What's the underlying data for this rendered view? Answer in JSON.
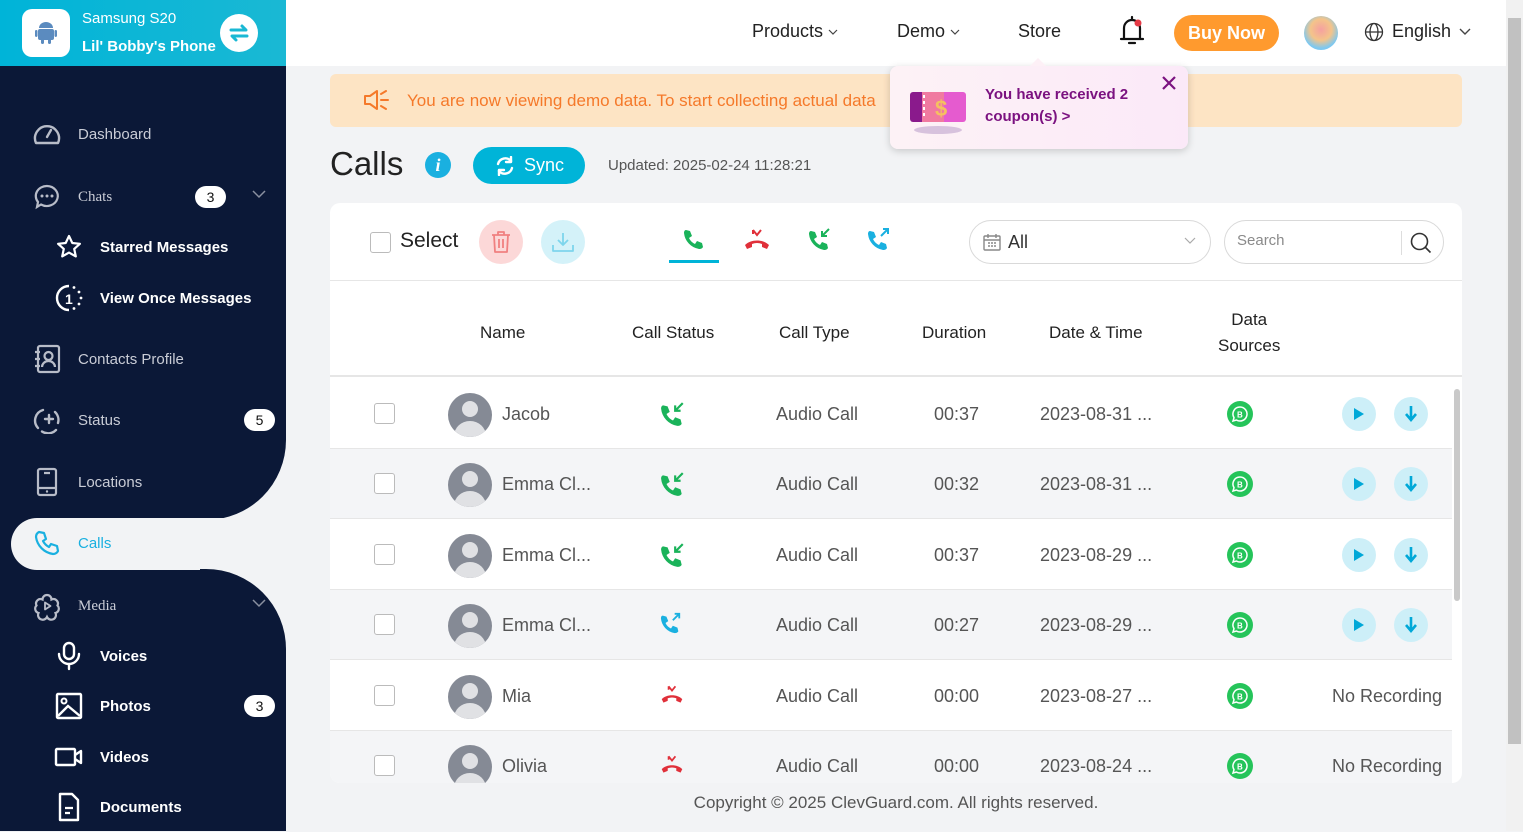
{
  "device": {
    "model": "Samsung S20",
    "name": "Lil' Bobby's Phone",
    "icon": "android-icon",
    "switch_icon": "switch-device-icon"
  },
  "sidebar": {
    "items": [
      {
        "label": "Dashboard",
        "icon": "dashboard-gauge-icon"
      },
      {
        "label": "Chats",
        "icon": "chat-bubble-icon",
        "badge": "3",
        "expandable": true
      },
      {
        "label": "Starred Messages",
        "icon": "star-icon",
        "sub": true
      },
      {
        "label": "View Once Messages",
        "icon": "view-once-icon",
        "sub": true
      },
      {
        "label": "Contacts Profile",
        "icon": "contacts-icon"
      },
      {
        "label": "Status",
        "icon": "status-add-icon",
        "badge": "5"
      },
      {
        "label": "Locations",
        "icon": "phone-device-icon"
      },
      {
        "label": "Calls",
        "icon": "phone-icon",
        "active": true
      },
      {
        "label": "Media",
        "icon": "media-flower-icon",
        "expandable": true
      },
      {
        "label": "Voices",
        "icon": "microphone-icon",
        "sub": true
      },
      {
        "label": "Photos",
        "icon": "image-icon",
        "sub": true,
        "badge": "3"
      },
      {
        "label": "Videos",
        "icon": "video-camera-icon",
        "sub": true
      },
      {
        "label": "Documents",
        "icon": "document-icon",
        "sub": true
      }
    ]
  },
  "topbar": {
    "products": "Products",
    "demo": "Demo",
    "store": "Store",
    "buy_now": "Buy Now",
    "language": "English"
  },
  "banner": {
    "text": "You are now viewing demo data. To start collecting actual data"
  },
  "coupon": {
    "text_line1": "You have received 2",
    "text_line2": "coupon(s) >"
  },
  "page": {
    "title": "Calls",
    "sync_label": "Sync",
    "updated": "Updated: 2025-02-24 11:28:21"
  },
  "toolbar": {
    "select_label": "Select",
    "filters": [
      "All calls",
      "Missed calls",
      "Incoming calls",
      "Outgoing calls"
    ],
    "date_filter": "All",
    "search_placeholder": "Search"
  },
  "table": {
    "headers": {
      "name": "Name",
      "status": "Call Status",
      "type": "Call Type",
      "duration": "Duration",
      "datetime": "Date & Time",
      "source_l1": "Data",
      "source_l2": "Sources"
    },
    "rows": [
      {
        "name": "Jacob",
        "status": "incoming",
        "type": "Audio Call",
        "duration": "00:37",
        "datetime": "2023-08-31 ...",
        "recording": true
      },
      {
        "name": "Emma Cl...",
        "status": "incoming",
        "type": "Audio Call",
        "duration": "00:32",
        "datetime": "2023-08-31 ...",
        "recording": true
      },
      {
        "name": "Emma Cl...",
        "status": "incoming",
        "type": "Audio Call",
        "duration": "00:37",
        "datetime": "2023-08-29 ...",
        "recording": true
      },
      {
        "name": "Emma Cl...",
        "status": "outgoing",
        "type": "Audio Call",
        "duration": "00:27",
        "datetime": "2023-08-29 ...",
        "recording": true
      },
      {
        "name": "Mia",
        "status": "missed",
        "type": "Audio Call",
        "duration": "00:00",
        "datetime": "2023-08-27 ...",
        "recording": false,
        "no_recording": "No Recording"
      },
      {
        "name": "Olivia",
        "status": "missed",
        "type": "Audio Call",
        "duration": "00:00",
        "datetime": "2023-08-24 ...",
        "recording": false,
        "no_recording": "No Recording"
      }
    ]
  },
  "colors": {
    "accent": "#00b4d8",
    "sidebar_bg": "#0b1837",
    "buy_now": "#ff9a2e",
    "incoming": "#1ab35a",
    "missed": "#e0303a",
    "outgoing": "#1ab0e0",
    "whatsapp_business": "#25c45a"
  },
  "footer": {
    "text": "Copyright © 2025 ClevGuard.com. All rights reserved."
  }
}
